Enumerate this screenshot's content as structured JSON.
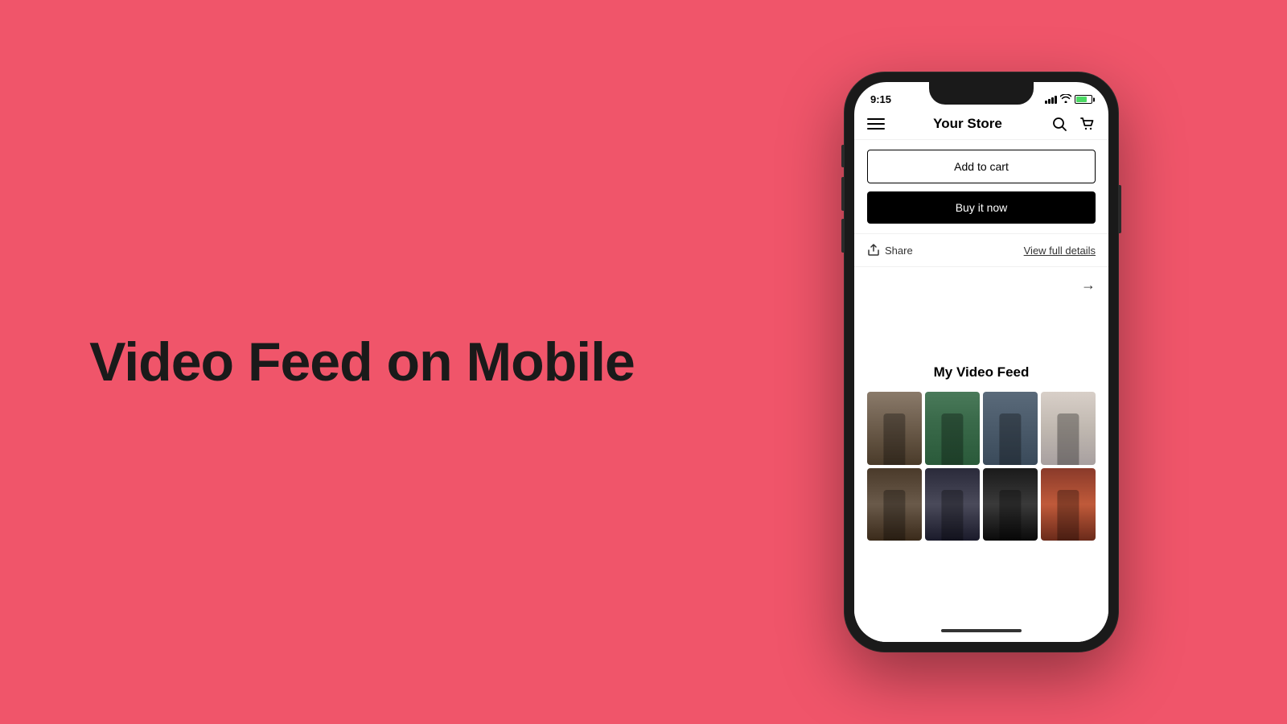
{
  "page": {
    "background_color": "#f0556a"
  },
  "left": {
    "hero_text": "Video Feed on Mobile"
  },
  "phone": {
    "status_bar": {
      "time": "9:15",
      "location_icon": "◂",
      "show_location": true
    },
    "nav": {
      "title": "Your Store",
      "menu_icon": "hamburger",
      "search_icon": "search",
      "cart_icon": "bag"
    },
    "buttons": {
      "add_to_cart": "Add to cart",
      "buy_it_now": "Buy it now"
    },
    "share_row": {
      "share_label": "Share",
      "view_full_label": "View full details"
    },
    "video_feed": {
      "title": "My Video Feed",
      "thumbnails": [
        {
          "id": 1,
          "class": "thumb-1"
        },
        {
          "id": 2,
          "class": "thumb-2"
        },
        {
          "id": 3,
          "class": "thumb-3"
        },
        {
          "id": 4,
          "class": "thumb-4"
        },
        {
          "id": 5,
          "class": "thumb-5"
        },
        {
          "id": 6,
          "class": "thumb-6"
        },
        {
          "id": 7,
          "class": "thumb-7"
        },
        {
          "id": 8,
          "class": "thumb-8"
        }
      ]
    }
  }
}
